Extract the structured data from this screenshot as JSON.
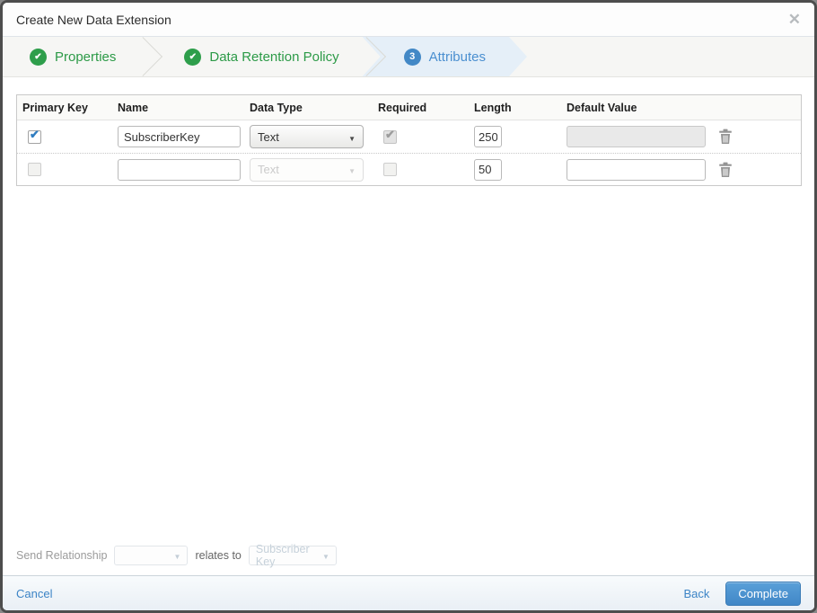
{
  "modal": {
    "title": "Create New Data Extension",
    "close_icon": "✕"
  },
  "steps": [
    {
      "label": "Properties",
      "state": "complete",
      "icon": "✔"
    },
    {
      "label": "Data Retention Policy",
      "state": "complete",
      "icon": "✔"
    },
    {
      "label": "Attributes",
      "state": "active",
      "number": "3"
    }
  ],
  "table": {
    "headers": [
      "Primary Key",
      "Name",
      "Data Type",
      "Required",
      "Length",
      "Default Value",
      ""
    ],
    "rows": [
      {
        "primary_key": true,
        "name": "SubscriberKey",
        "data_type": "Text",
        "data_type_disabled": false,
        "required": true,
        "required_disabled": true,
        "length": "250",
        "default_value": "",
        "default_value_disabled": true
      },
      {
        "primary_key": false,
        "name": "",
        "data_type": "Text",
        "data_type_disabled": true,
        "required": false,
        "required_disabled": false,
        "length": "50",
        "default_value": "",
        "default_value_disabled": false
      }
    ],
    "checkmark": "✔"
  },
  "send_relationship": {
    "label": "Send Relationship",
    "relates_to_label": "relates to",
    "target_field": "Subscriber Key"
  },
  "footer": {
    "cancel_label": "Cancel",
    "back_label": "Back",
    "complete_label": "Complete"
  },
  "colors": {
    "step_green": "#2e9e4b",
    "step_blue_badge": "#4288c6",
    "step_blue_text": "#4a8fd0",
    "active_step_bg": "#e5eff8",
    "link_blue": "#3c84c6",
    "complete_button_top": "#5aa0d8",
    "complete_button_bottom": "#4187c7",
    "checkbox_check_blue": "#2f7dc0",
    "modal_border": "#4d4d4d"
  }
}
